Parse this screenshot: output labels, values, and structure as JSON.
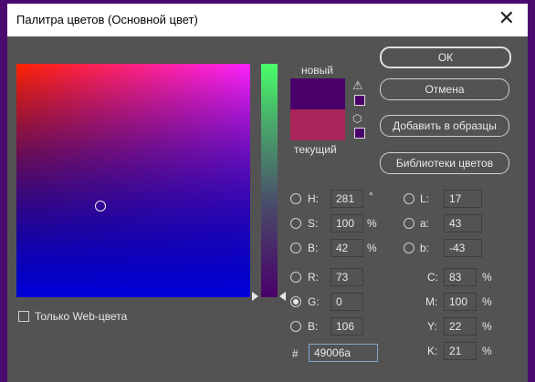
{
  "window": {
    "title": "Палитра цветов (Основной цвет)",
    "close_symbol": "✕"
  },
  "preview": {
    "new_label": "новый",
    "current_label": "текущий",
    "new_color": "#49006a",
    "current_color": "#a8245a"
  },
  "buttons": {
    "ok": "ОК",
    "cancel": "Отмена",
    "add_swatch": "Добавить в образцы",
    "libraries": "Библиотеки цветов"
  },
  "web_only": {
    "label": "Только Web-цвета",
    "checked": false
  },
  "hsb": {
    "h": {
      "label": "H:",
      "value": "281",
      "unit": "°"
    },
    "s": {
      "label": "S:",
      "value": "100",
      "unit": "%"
    },
    "b": {
      "label": "B:",
      "value": "42",
      "unit": "%"
    }
  },
  "rgb": {
    "r": {
      "label": "R:",
      "value": "73"
    },
    "g": {
      "label": "G:",
      "value": "0"
    },
    "b": {
      "label": "B:",
      "value": "106"
    }
  },
  "lab": {
    "l": {
      "label": "L:",
      "value": "17"
    },
    "a": {
      "label": "a:",
      "value": "43"
    },
    "b": {
      "label": "b:",
      "value": "-43"
    }
  },
  "cmyk": {
    "c": {
      "label": "C:",
      "value": "83",
      "unit": "%"
    },
    "m": {
      "label": "M:",
      "value": "100",
      "unit": "%"
    },
    "y": {
      "label": "Y:",
      "value": "22",
      "unit": "%"
    },
    "k": {
      "label": "K:",
      "value": "21",
      "unit": "%"
    }
  },
  "hex": {
    "label": "#",
    "value": "49006a"
  },
  "selected_channel": "G",
  "icons": {
    "warning": "warning-icon",
    "cube": "web-safe-cube-icon"
  }
}
